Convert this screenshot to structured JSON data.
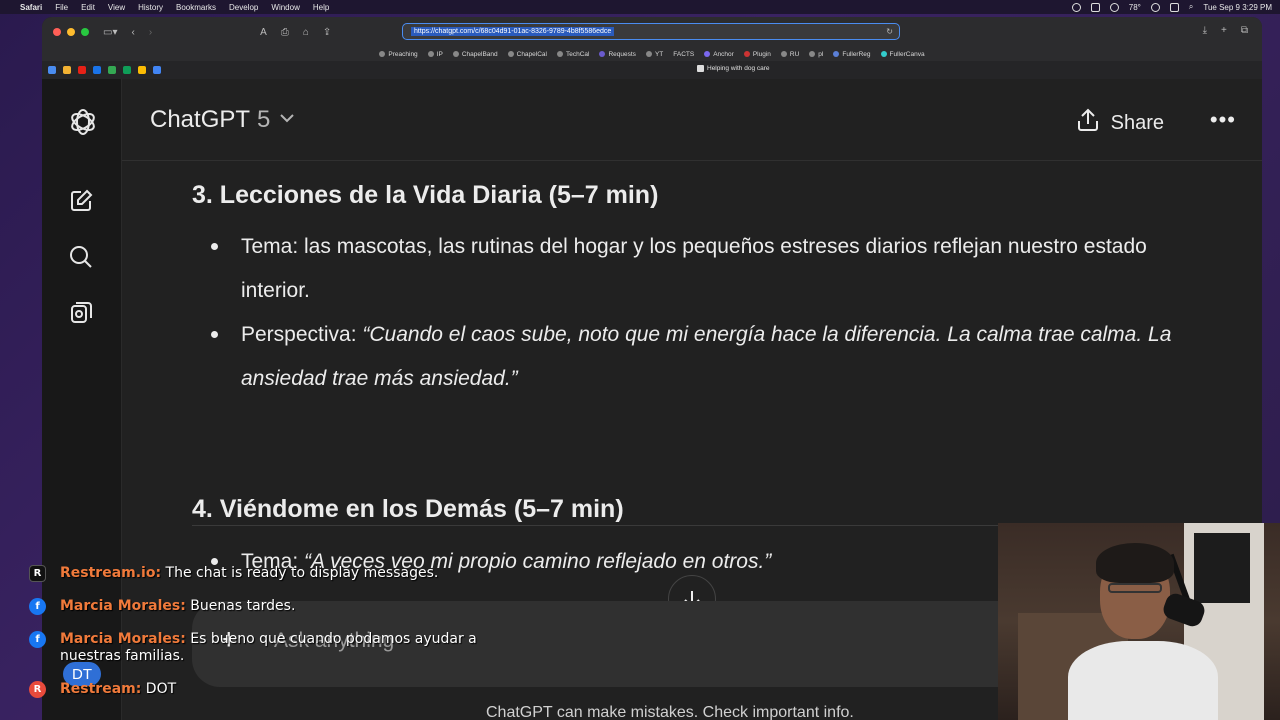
{
  "menubar": {
    "app": "Safari",
    "items": [
      "File",
      "Edit",
      "View",
      "History",
      "Bookmarks",
      "Develop",
      "Window",
      "Help"
    ],
    "temperature": "78°",
    "datetime": "Tue Sep 9  3:29 PM"
  },
  "browser": {
    "url": "https://chatgpt.com/c/68c04d91-01ac-8326-9789-4b8f5586edce",
    "favorites": [
      "Preaching",
      "IP",
      "ChapelBand",
      "ChapelCal",
      "TechCal",
      "Requests",
      "YT",
      "FACTS",
      "Anchor",
      "Plugin",
      "RU",
      "pl",
      "FullerReg",
      "FullerCanva"
    ],
    "tab_title": "Helping with dog care"
  },
  "app": {
    "model_name": "ChatGPT",
    "model_version": "5",
    "share_label": "Share",
    "composer_placeholder": "Ask anything",
    "disclaimer": "ChatGPT can make mistakes. Check important info."
  },
  "content": {
    "section3": {
      "heading": "3. Lecciones de la Vida Diaria (5–7 min)",
      "bullet1": "Tema: las mascotas, las rutinas del hogar y los pequeños estreses diarios reflejan nuestro estado interior.",
      "bullet2_label": "Perspectiva: ",
      "bullet2_quote": "“Cuando el caos sube, noto que mi energía hace la diferencia. La calma trae calma. La ansiedad trae más ansiedad.”"
    },
    "section4": {
      "heading": "4. Viéndome en los Demás (5–7 min)",
      "bullet1_label": "Tema: ",
      "bullet1_quote": "“A veces veo mi propio camino reflejado en otros.”"
    }
  },
  "chat_overlay": {
    "messages": [
      {
        "author": "Restream.io:",
        "text": "The chat is ready to display messages."
      },
      {
        "author": "Marcia Morales:",
        "text": "Buenas tardes."
      },
      {
        "author": "Marcia Morales:",
        "text": "Es bueno que cuando podamos ayudar a nuestras familias."
      },
      {
        "author": "Restream:",
        "text": "DOT"
      }
    ],
    "avatar_initials": "DT"
  },
  "colors": {
    "background": "#212121",
    "author": "#f07a3b",
    "facebook": "#1877f2"
  }
}
